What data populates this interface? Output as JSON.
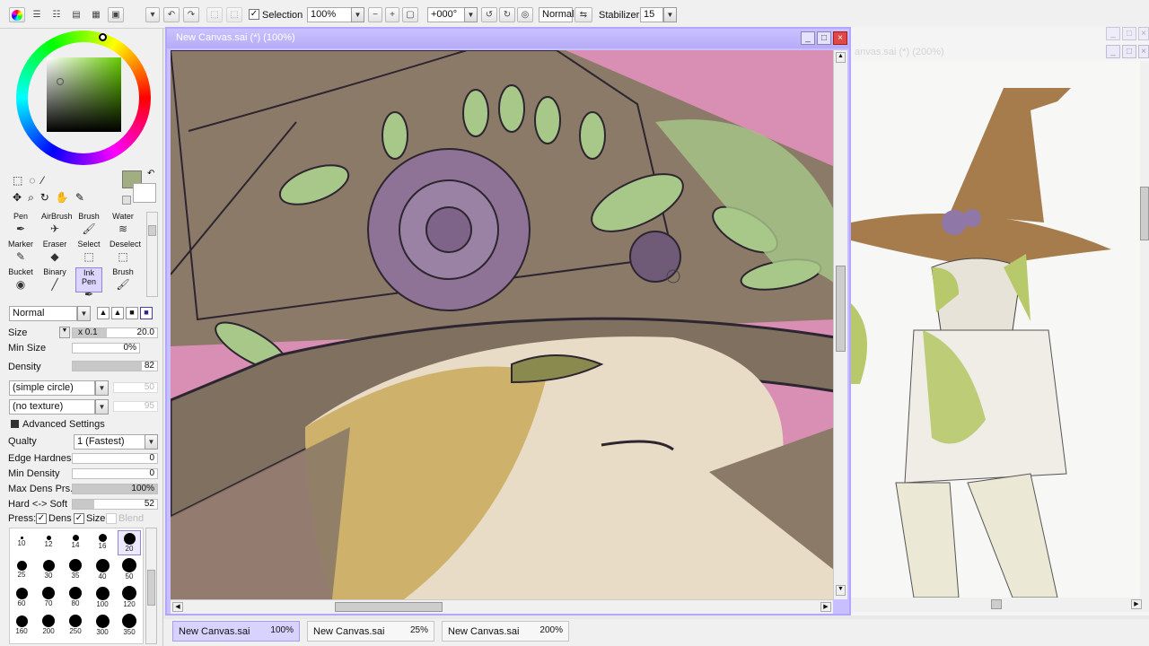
{
  "toolbar": {
    "selection_label": "Selection",
    "zoom_value": "100%",
    "rotation_value": "+000°",
    "blend_mode": "Normal",
    "stabilizer_label": "Stabilizer",
    "stabilizer_value": "15"
  },
  "colors": {
    "accent": "#b3a6ff",
    "current_color": "#a3ad82",
    "canvas_pink": "#d98fb3",
    "hat_brown": "#8b7a67",
    "leaf_green": "#a8c88a",
    "rose_purple": "#8e7396"
  },
  "tools": [
    {
      "label": "Pen",
      "icon": "pen-icon"
    },
    {
      "label": "AirBrush",
      "icon": "airbrush-icon"
    },
    {
      "label": "Brush",
      "icon": "brush-icon"
    },
    {
      "label": "Water",
      "icon": "water-icon"
    },
    {
      "label": "Marker",
      "icon": "marker-icon"
    },
    {
      "label": "Eraser",
      "icon": "eraser-icon"
    },
    {
      "label": "Select",
      "icon": "select-icon"
    },
    {
      "label": "Deselect",
      "icon": "deselect-icon"
    },
    {
      "label": "Bucket",
      "icon": "bucket-icon"
    },
    {
      "label": "Binary",
      "icon": "binary-icon"
    },
    {
      "label": "Ink Pen",
      "icon": "inkpen-icon"
    },
    {
      "label": "Brush",
      "icon": "brush-icon"
    }
  ],
  "brush": {
    "mode": "Normal",
    "size_label": "Size",
    "size_multiplier": "x 0.1",
    "size_value": "20.0",
    "min_size_label": "Min Size",
    "min_size_value": "0%",
    "density_label": "Density",
    "density_value": "82",
    "shape": "(simple circle)",
    "shape_value": "50",
    "texture": "(no texture)",
    "texture_value": "95",
    "advanced_label": "Advanced Settings",
    "quality_label": "Qualty",
    "quality_value": "1 (Fastest)",
    "edge_hardness_label": "Edge Hardness",
    "edge_hardness_value": "0",
    "min_density_label": "Min Density",
    "min_density_value": "0",
    "max_dens_label": "Max Dens Prs.",
    "max_dens_value": "100%",
    "hard_soft_label": "Hard <-> Soft",
    "hard_soft_value": "52",
    "press_label": "Press:",
    "dens_label": "Dens",
    "size_chk_label": "Size",
    "blend_label": "Blend"
  },
  "brush_sizes": [
    "10",
    "12",
    "14",
    "16",
    "20",
    "25",
    "30",
    "35",
    "40",
    "50",
    "60",
    "70",
    "80",
    "100",
    "120",
    "160",
    "200",
    "250",
    "300",
    "350"
  ],
  "canvas_window": {
    "title": "New Canvas.sai (*) (100%)"
  },
  "ref_window": {
    "title_ghost": "anvas.sai (*) (200%)"
  },
  "tabs": [
    {
      "label": "New Canvas.sai",
      "zoom": "100%"
    },
    {
      "label": "New Canvas.sai",
      "zoom": "25%"
    },
    {
      "label": "New Canvas.sai",
      "zoom": "200%"
    }
  ]
}
